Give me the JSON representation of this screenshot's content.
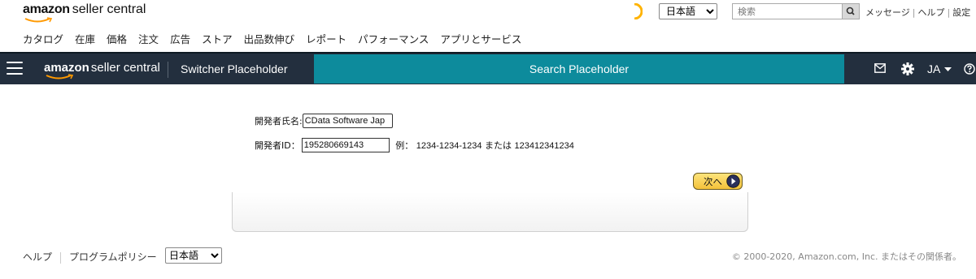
{
  "brand": {
    "logo_main": "amazon",
    "logo_sub": "seller central"
  },
  "top": {
    "language_selected": "日本語",
    "language_options": [
      "日本語"
    ],
    "search_placeholder": "検索",
    "links": [
      "メッセージ",
      "ヘルプ",
      "設定"
    ]
  },
  "catnav": [
    "カタログ",
    "在庫",
    "価格",
    "注文",
    "広告",
    "ストア",
    "出品数伸び",
    "レポート",
    "パフォーマンス",
    "アプリとサービス"
  ],
  "header": {
    "logo_main": "amazon",
    "logo_sub": "seller central",
    "switcher": "Switcher Placeholder",
    "search": "Search Placeholder",
    "lang": "JA"
  },
  "form": {
    "dev_name_label": "開発者氏名:",
    "dev_name_value": "CData Software Jap",
    "dev_id_label": "開発者ID：",
    "dev_id_value": "195280669143",
    "example_prefix": "例：",
    "example_1": "1234-1234-1234",
    "example_mid": "または",
    "example_2": "123412341234",
    "next_label": "次へ"
  },
  "footer": {
    "help": "ヘルプ",
    "policy": "プログラムポリシー",
    "language_selected": "日本語",
    "copyright": "© 2000-2020, Amazon.com, Inc. またはその関係者。"
  },
  "colors": {
    "header_bg": "#232f3e",
    "search_bg": "#0d8b9c",
    "amazon_orange": "#ff9900",
    "button_yellow": "#f3c23a"
  }
}
